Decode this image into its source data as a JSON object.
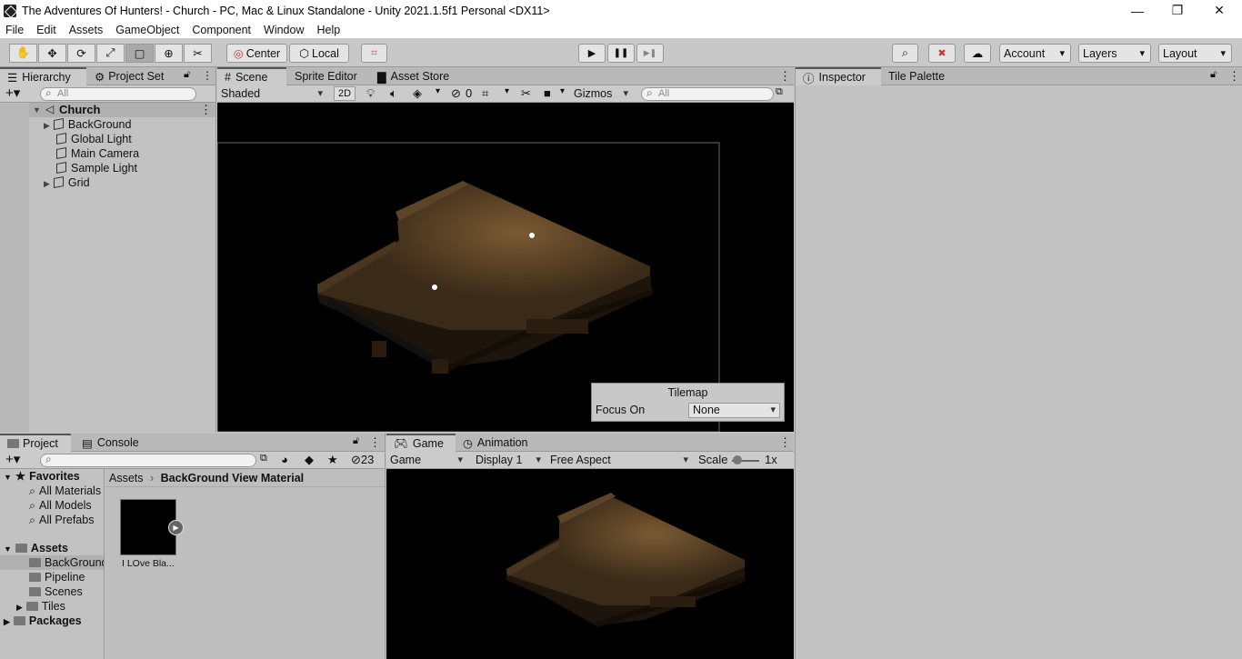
{
  "window": {
    "title": "The Adventures Of Hunters! - Church - PC, Mac & Linux Standalone - Unity 2021.1.5f1 Personal <DX11>",
    "minimize": "—",
    "restore": "❐",
    "close": "✕"
  },
  "menu": [
    "File",
    "Edit",
    "Assets",
    "GameObject",
    "Component",
    "Window",
    "Help"
  ],
  "toolbar": {
    "tools": [
      "hand-tool",
      "move-tool",
      "rotate-tool",
      "scale-tool",
      "rect-tool",
      "transform-tool",
      "custom-tool"
    ],
    "tool_glyphs": [
      "✋",
      "✥",
      "⟳",
      "⤢",
      "▢",
      "⊕",
      "✂"
    ],
    "pivot": "Center",
    "space": "Local",
    "play": "▶",
    "pause": "❚❚",
    "step": "▶❚",
    "account": "Account",
    "layers": "Layers",
    "layout": "Layout"
  },
  "hierarchy": {
    "tabs": [
      "Hierarchy",
      "Project Set"
    ],
    "search_placeholder": "All",
    "scene": "Church",
    "items": [
      "BackGround",
      "Global Light",
      "Main Camera",
      "Sample Light",
      "Grid"
    ]
  },
  "scene_panel": {
    "tabs": [
      "Scene",
      "Sprite Editor",
      "Asset Store"
    ],
    "shading": "Shaded",
    "mode_2d": "2D",
    "hidden_count": "0",
    "gizmos": "Gizmos",
    "search_placeholder": "All",
    "tilemap_overlay": {
      "title": "Tilemap",
      "label": "Focus On",
      "value": "None"
    }
  },
  "inspector": {
    "tabs": [
      "Inspector",
      "Tile Palette"
    ]
  },
  "project": {
    "tabs": [
      "Project",
      "Console"
    ],
    "hidden_count": "23",
    "favorites_label": "Favorites",
    "favorites": [
      "All Materials",
      "All Models",
      "All Prefabs"
    ],
    "assets_label": "Assets",
    "folders": [
      "BackGround",
      "Pipeline",
      "Scenes",
      "Tiles"
    ],
    "packages_label": "Packages",
    "breadcrumb": [
      "Assets",
      "BackGround View Material"
    ],
    "asset_name": "I LOve Bla..."
  },
  "game_panel": {
    "tabs": [
      "Game",
      "Animation"
    ],
    "mode": "Game",
    "display": "Display 1",
    "aspect": "Free Aspect",
    "scale_label": "Scale",
    "scale_value": "1x"
  }
}
